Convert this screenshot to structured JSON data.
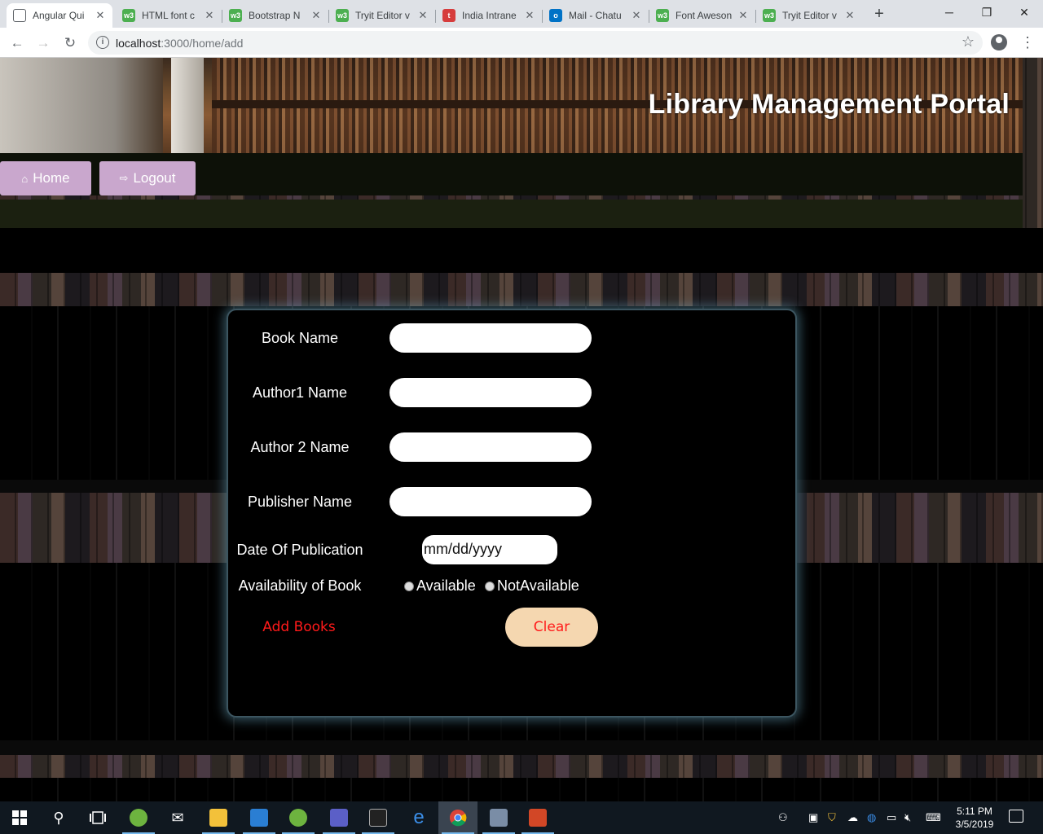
{
  "browser": {
    "tabs": [
      {
        "title": "Angular Qui",
        "icon": "document-icon",
        "active": true
      },
      {
        "title": "HTML font c",
        "icon": "w3schools-icon"
      },
      {
        "title": "Bootstrap N",
        "icon": "w3schools-icon"
      },
      {
        "title": "Tryit Editor v",
        "icon": "w3schools-icon"
      },
      {
        "title": "India Intrane",
        "icon": "t-icon"
      },
      {
        "title": "Mail - Chatu",
        "icon": "outlook-icon"
      },
      {
        "title": "Font Aweson",
        "icon": "w3schools-icon"
      },
      {
        "title": "Tryit Editor v",
        "icon": "w3schools-icon"
      }
    ],
    "new_tab": "+",
    "url_host": "localhost",
    "url_rest": ":3000/home/add",
    "window_controls": {
      "minimize": "─",
      "restore": "❐",
      "close": "✕"
    }
  },
  "header": {
    "title": "Library Management Portal"
  },
  "nav": {
    "home_label": "Home",
    "logout_label": "Logout"
  },
  "form": {
    "book_name_label": "Book Name",
    "author1_label": "Author1 Name",
    "author2_label": "Author 2 Name",
    "publisher_label": "Publisher Name",
    "date_label": "Date Of Publication",
    "date_placeholder": "mm/dd/yyyy",
    "availability_label": "Availability of Book",
    "available_label": "Available",
    "not_available_label": "NotAvailable",
    "add_button": "Add Books",
    "clear_button": "Clear"
  },
  "taskbar": {
    "time": "5:11 PM",
    "date": "3/5/2019"
  },
  "colors": {
    "nav_button": "#c9a7cd",
    "clear_button": "#f5d7b0",
    "button_text": "#ff1a1a",
    "panel_glow": "#78bedc"
  }
}
